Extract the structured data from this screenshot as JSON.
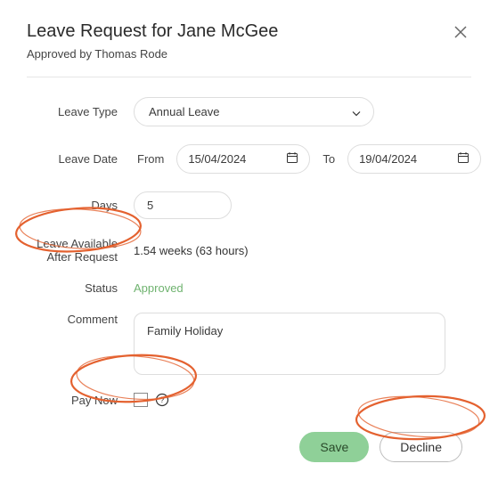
{
  "header": {
    "title": "Leave Request for Jane McGee",
    "subtitle_prefix": "Approved by ",
    "approver": "Thomas Rode"
  },
  "labels": {
    "leave_type": "Leave Type",
    "leave_date": "Leave Date",
    "from": "From",
    "to": "To",
    "days": "Days",
    "leave_available_l1": "Leave Available",
    "leave_available_l2": "After Request",
    "status": "Status",
    "comment": "Comment",
    "pay_now": "Pay Now"
  },
  "values": {
    "leave_type": "Annual Leave",
    "date_from": "15/04/2024",
    "date_to": "19/04/2024",
    "days": "5",
    "leave_available": "1.54 weeks (63 hours)",
    "status": "Approved",
    "comment": "Family Holiday",
    "pay_now_checked": false
  },
  "buttons": {
    "save": "Save",
    "decline": "Decline"
  },
  "icons": {
    "close": "close-icon",
    "calendar": "calendar-icon",
    "dropdown": "chevron-down-icon",
    "help": "help-icon"
  },
  "colors": {
    "status_ok": "#6fb36f",
    "save_bg": "#8fd098",
    "annotation": "#e4612f"
  }
}
